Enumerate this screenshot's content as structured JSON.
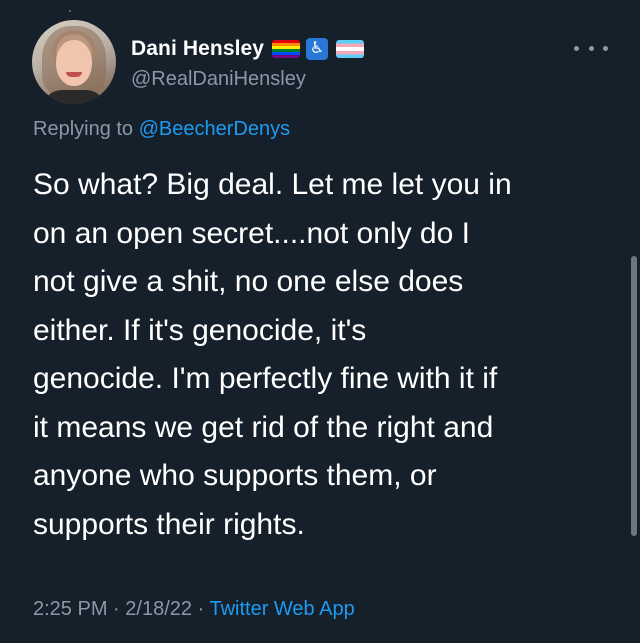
{
  "author": {
    "display_name": "Dani Hensley",
    "handle": "@RealDaniHensley",
    "badges": [
      "rainbow-flag",
      "accessibility-icon",
      "trans-flag"
    ]
  },
  "reply": {
    "prefix": "Replying to",
    "mention": "@BeecherDenys"
  },
  "tweet": {
    "lines": [
      "So what? Big deal. Let me let you in",
      "on an open secret....not only do I",
      "not give a shit, no one else does",
      "either. If it's genocide, it's",
      "genocide. I'm perfectly fine with it if",
      "it means we get rid of the right and",
      "anyone who supports them, or",
      "supports their rights."
    ]
  },
  "meta": {
    "time": "2:25 PM",
    "separator": "·",
    "date": "2/18/22",
    "source": "Twitter Web App"
  },
  "icons": {
    "more": "more-horizontal-icon",
    "accessibility_glyph": "♿"
  },
  "colors": {
    "background": "#15202b",
    "text_primary": "#ffffff",
    "text_secondary": "#8b98a5",
    "link": "#1d9bf0"
  }
}
